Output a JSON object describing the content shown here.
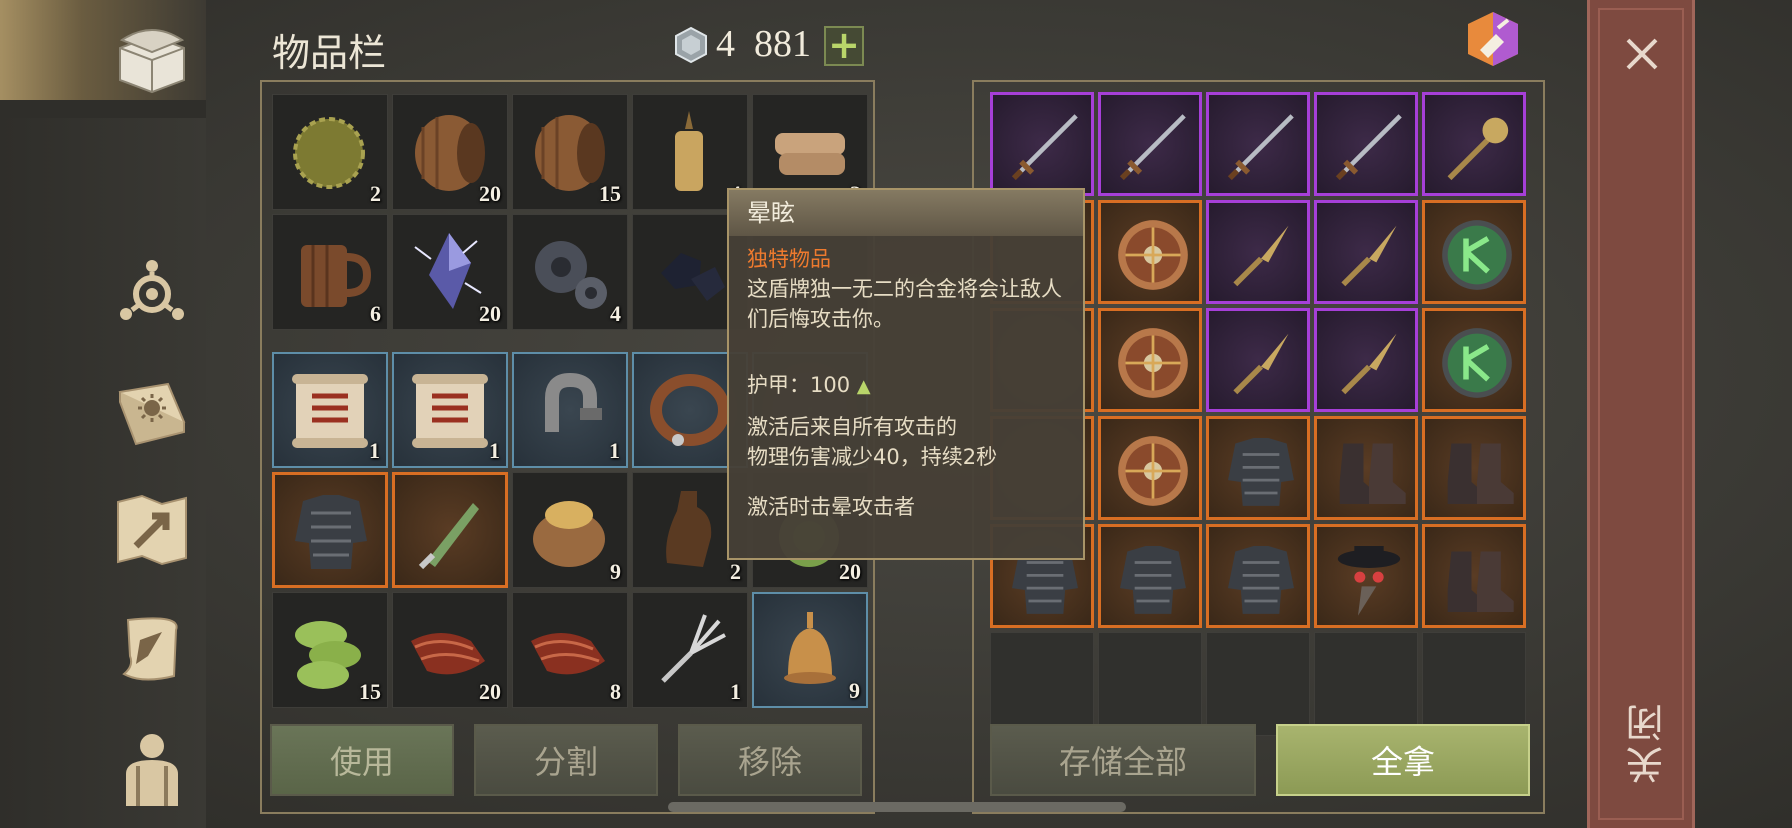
{
  "header": {
    "title": "物品栏",
    "currency_amount": "4  881",
    "add_label": "+"
  },
  "sidebar": {
    "items": [
      {
        "icon": "chest-icon"
      },
      {
        "icon": "crafting-icon"
      },
      {
        "icon": "skills-book-icon"
      },
      {
        "icon": "map-icon"
      },
      {
        "icon": "quest-scroll-icon"
      },
      {
        "icon": "character-icon"
      }
    ]
  },
  "inventory": {
    "top_rows": [
      [
        {
          "item": "hay-bale",
          "count": "2"
        },
        {
          "item": "barrel",
          "count": "20"
        },
        {
          "item": "barrel",
          "count": "15"
        },
        {
          "item": "candle",
          "count": "4"
        },
        {
          "item": "cloth",
          "count": "3"
        }
      ],
      [
        {
          "item": "tankard",
          "count": "6"
        },
        {
          "item": "crystal",
          "count": "20"
        },
        {
          "item": "gears",
          "count": "4"
        },
        {
          "item": "coal",
          "count": ""
        },
        {
          "item": "hidden",
          "count": ""
        }
      ]
    ],
    "bottom_rows": [
      [
        {
          "item": "recipe-scroll",
          "count": "1",
          "rarity": "blue"
        },
        {
          "item": "recipe-scroll",
          "count": "1",
          "rarity": "blue"
        },
        {
          "item": "iron-clamp",
          "count": "1",
          "rarity": "blue"
        },
        {
          "item": "leather-collar",
          "count": "",
          "rarity": "blue"
        },
        {
          "item": "hidden",
          "count": "",
          "rarity": "blue"
        }
      ],
      [
        {
          "item": "chainmail",
          "count": "",
          "rarity": "orange"
        },
        {
          "item": "dagger",
          "count": "",
          "rarity": "orange"
        },
        {
          "item": "grain-sack",
          "count": "9",
          "rarity": "none"
        },
        {
          "item": "bottle",
          "count": "2",
          "rarity": "none"
        },
        {
          "item": "cabbage",
          "count": "20",
          "rarity": "none"
        }
      ],
      [
        {
          "item": "cucumber-slices",
          "count": "15",
          "rarity": "none"
        },
        {
          "item": "raw-meat",
          "count": "20",
          "rarity": "none"
        },
        {
          "item": "raw-meat",
          "count": "8",
          "rarity": "none"
        },
        {
          "item": "meat-fork",
          "count": "1",
          "rarity": "none"
        },
        {
          "item": "bell",
          "count": "9",
          "rarity": "blue"
        }
      ]
    ]
  },
  "storage": {
    "rows": [
      [
        {
          "item": "sword",
          "rarity": "purple"
        },
        {
          "item": "sword",
          "rarity": "purple"
        },
        {
          "item": "sword",
          "rarity": "purple"
        },
        {
          "item": "sword",
          "rarity": "purple"
        },
        {
          "item": "mace",
          "rarity": "purple"
        }
      ],
      [
        {
          "item": "hidden",
          "rarity": "orange"
        },
        {
          "item": "round-shield",
          "rarity": "orange"
        },
        {
          "item": "spear-head",
          "rarity": "purple"
        },
        {
          "item": "spear-head",
          "rarity": "purple"
        },
        {
          "item": "rune-shield",
          "rarity": "orange"
        }
      ],
      [
        {
          "item": "hidden",
          "rarity": "orange"
        },
        {
          "item": "round-shield",
          "rarity": "orange"
        },
        {
          "item": "spear-head",
          "rarity": "purple"
        },
        {
          "item": "spear-head",
          "rarity": "purple"
        },
        {
          "item": "rune-shield",
          "rarity": "orange"
        }
      ],
      [
        {
          "item": "hidden",
          "rarity": "orange"
        },
        {
          "item": "round-shield",
          "rarity": "orange"
        },
        {
          "item": "chainmail",
          "rarity": "orange"
        },
        {
          "item": "boots",
          "rarity": "orange"
        },
        {
          "item": "boots",
          "rarity": "orange"
        }
      ],
      [
        {
          "item": "chainmail",
          "rarity": "orange"
        },
        {
          "item": "chainmail",
          "rarity": "orange"
        },
        {
          "item": "chainmail",
          "rarity": "orange"
        },
        {
          "item": "plague-mask",
          "rarity": "orange"
        },
        {
          "item": "boots",
          "rarity": "orange"
        }
      ],
      [
        {
          "item": "empty",
          "rarity": "empty"
        },
        {
          "item": "empty",
          "rarity": "empty"
        },
        {
          "item": "empty",
          "rarity": "empty"
        },
        {
          "item": "empty",
          "rarity": "empty"
        },
        {
          "item": "empty",
          "rarity": "empty"
        }
      ]
    ]
  },
  "buttons": {
    "use": "使用",
    "split": "分割",
    "remove": "移除",
    "store_all": "存储全部",
    "take_all": "全拿"
  },
  "tooltip": {
    "title": "晕眩",
    "rarity": "独特物品",
    "description": "这盾牌独一无二的合金将会让敌人们后悔攻击你。",
    "armor_label": "护甲：",
    "armor_value": "100",
    "armor_arrow": "▲",
    "effect_line1": "激活后来自所有攻击的",
    "effect_line2": "物理伤害减少40，持续2秒",
    "effect_stun": "激活时击晕攻击者"
  },
  "close": {
    "label": "关闭",
    "x": "✕"
  },
  "colors": {
    "rarity_orange": "#d86e23",
    "rarity_purple": "#a63fd8",
    "rarity_blue": "#5e8ea8",
    "take_all_green": "#a8b46e"
  }
}
